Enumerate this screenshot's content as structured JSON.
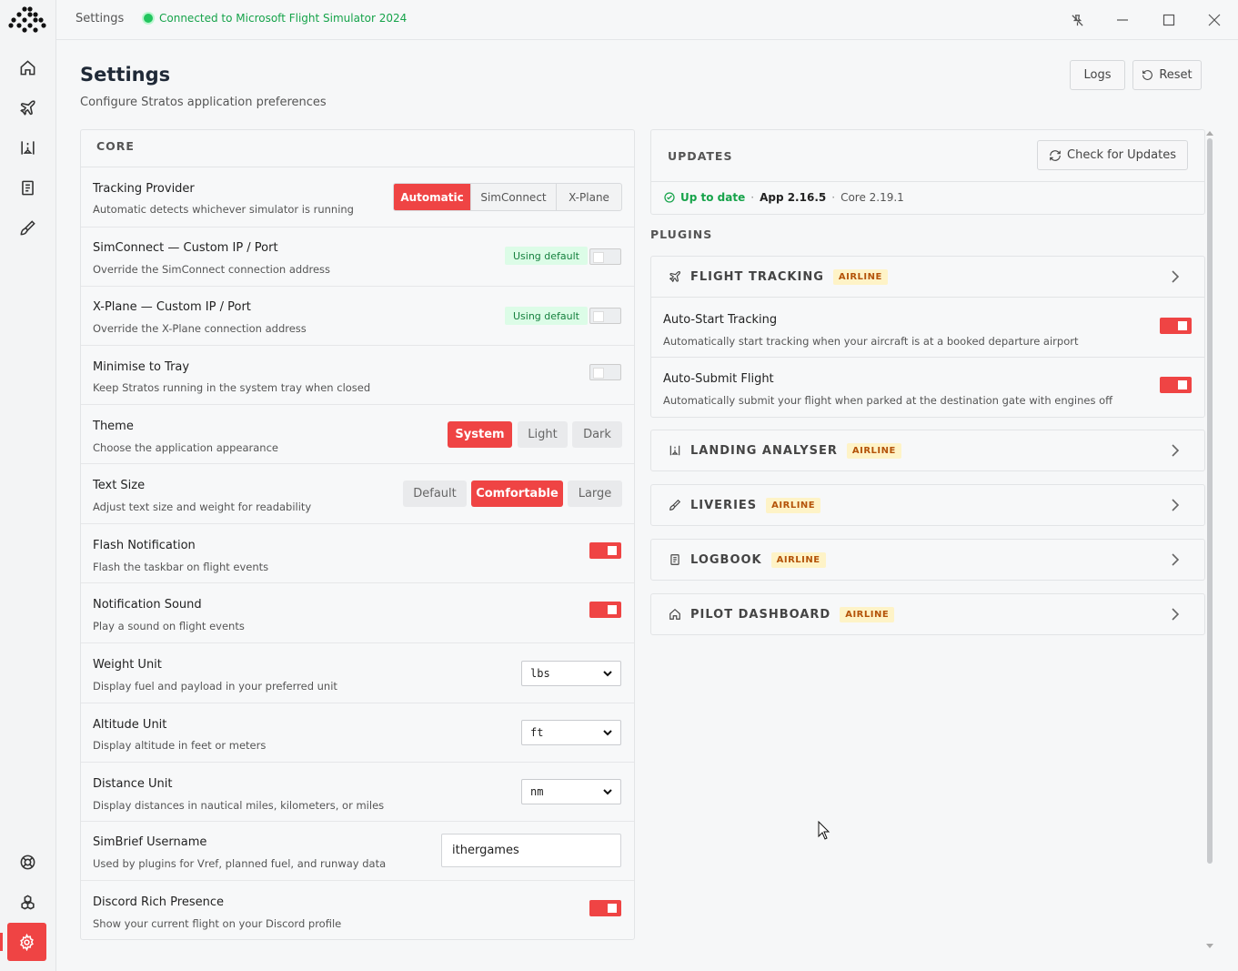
{
  "topbar": {
    "title": "Settings",
    "status": "Connected to Microsoft Flight Simulator 2024"
  },
  "sidebar": {
    "items": [
      "home-icon",
      "plane-icon",
      "landing-icon",
      "logbook-icon",
      "brush-icon",
      "help-icon",
      "plugins-icon",
      "settings-icon"
    ],
    "active_color": "#ef4444"
  },
  "header": {
    "title": "Settings",
    "subtitle": "Configure Stratos application preferences",
    "logs_label": "Logs",
    "reset_label": "Reset"
  },
  "core": {
    "heading": "CORE",
    "tracking": {
      "label": "Tracking Provider",
      "desc": "Automatic detects whichever simulator is running",
      "options": [
        "Automatic",
        "SimConnect",
        "X-Plane"
      ],
      "selected": "Automatic"
    },
    "simconnect": {
      "label": "SimConnect — Custom IP / Port",
      "desc": "Override the SimConnect connection address",
      "badge": "Using default",
      "enabled": false
    },
    "xplane": {
      "label": "X-Plane — Custom IP / Port",
      "desc": "Override the X-Plane connection address",
      "badge": "Using default",
      "enabled": false
    },
    "tray": {
      "label": "Minimise to Tray",
      "desc": "Keep Stratos running in the system tray when closed",
      "enabled": false
    },
    "theme": {
      "label": "Theme",
      "desc": "Choose the application appearance",
      "options": [
        "System",
        "Light",
        "Dark"
      ],
      "selected": "System"
    },
    "textsize": {
      "label": "Text Size",
      "desc": "Adjust text size and weight for readability",
      "options": [
        "Default",
        "Comfortable",
        "Large"
      ],
      "selected": "Comfortable"
    },
    "flash": {
      "label": "Flash Notification",
      "desc": "Flash the taskbar on flight events",
      "enabled": true
    },
    "sound": {
      "label": "Notification Sound",
      "desc": "Play a sound on flight events",
      "enabled": true
    },
    "weight": {
      "label": "Weight Unit",
      "desc": "Display fuel and payload in your preferred unit",
      "value": "lbs"
    },
    "altitude": {
      "label": "Altitude Unit",
      "desc": "Display altitude in feet or meters",
      "value": "ft"
    },
    "distance": {
      "label": "Distance Unit",
      "desc": "Display distances in nautical miles, kilometers, or miles",
      "value": "nm"
    },
    "simbrief": {
      "label": "SimBrief Username",
      "desc": "Used by plugins for Vref, planned fuel, and runway data",
      "value": "ithergames"
    },
    "discord": {
      "label": "Discord Rich Presence",
      "desc": "Show your current flight on your Discord profile",
      "enabled": true
    }
  },
  "updates": {
    "heading": "UPDATES",
    "check_label": "Check for Updates",
    "status": "Up to date",
    "app_version": "App 2.16.5",
    "core_version": "Core 2.19.1"
  },
  "plugins": {
    "heading": "PLUGINS",
    "items": [
      {
        "name": "FLIGHT TRACKING",
        "tag": "AIRLINE",
        "icon": "plane-icon",
        "expanded": true
      },
      {
        "name": "LANDING ANALYSER",
        "tag": "AIRLINE",
        "icon": "landing-icon"
      },
      {
        "name": "LIVERIES",
        "tag": "AIRLINE",
        "icon": "brush-icon"
      },
      {
        "name": "LOGBOOK",
        "tag": "AIRLINE",
        "icon": "logbook-icon"
      },
      {
        "name": "PILOT DASHBOARD",
        "tag": "AIRLINE",
        "icon": "home-icon"
      }
    ],
    "flight_tracking": {
      "autostart_label": "Auto-Start Tracking",
      "autostart_desc": "Automatically start tracking when your aircraft is at a booked departure airport",
      "autostart_enabled": true,
      "autosubmit_label": "Auto-Submit Flight",
      "autosubmit_desc": "Automatically submit your flight when parked at the destination gate with engines off",
      "autosubmit_enabled": true
    }
  }
}
